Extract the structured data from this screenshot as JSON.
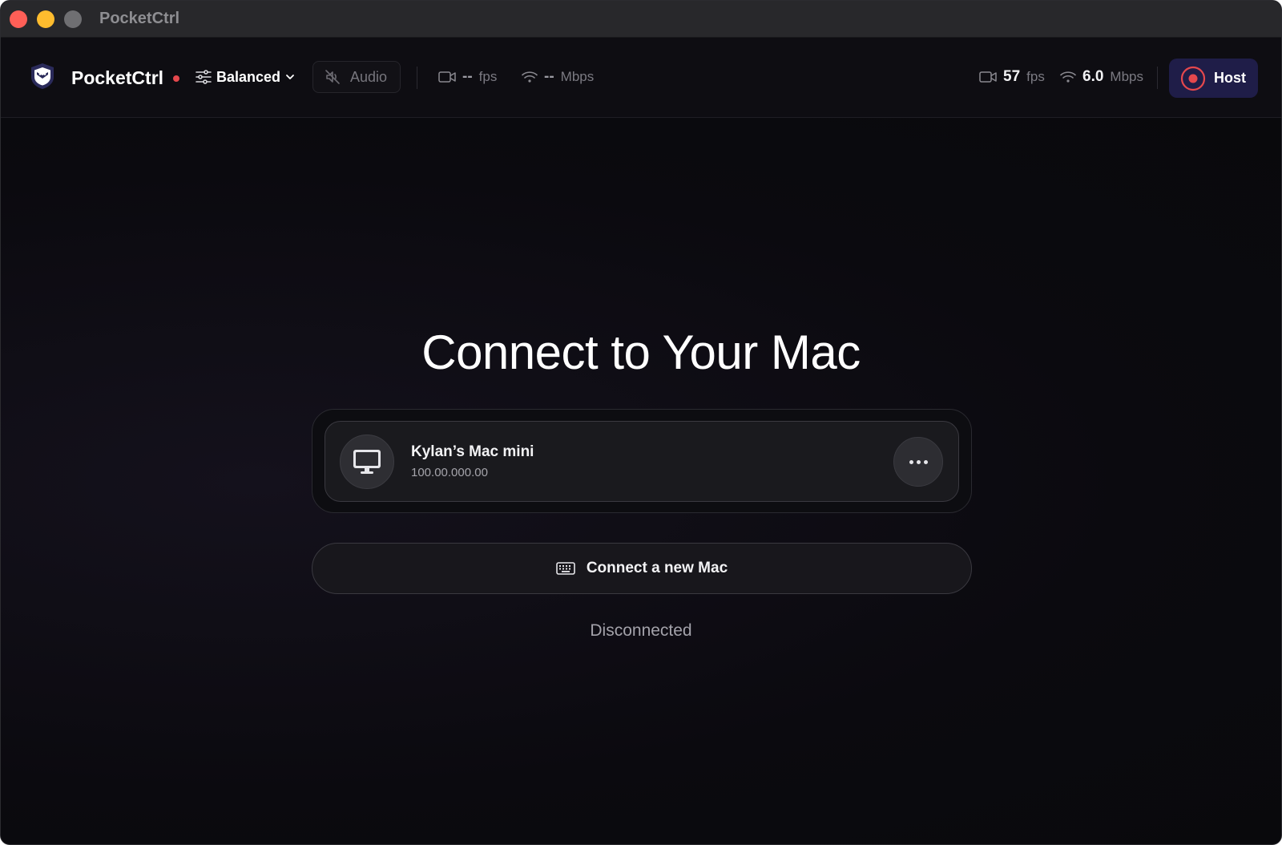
{
  "window": {
    "title": "PocketCtrl"
  },
  "toolbar": {
    "app_name": "PocketCtrl",
    "quality_label": "Balanced",
    "audio_label": "Audio",
    "remote_fps_value": "--",
    "remote_fps_unit": "fps",
    "remote_bw_value": "--",
    "remote_bw_unit": "Mbps",
    "local_fps_value": "57",
    "local_fps_unit": "fps",
    "local_bw_value": "6.0",
    "local_bw_unit": "Mbps",
    "host_label": "Host"
  },
  "main": {
    "heading": "Connect to Your Mac",
    "devices": [
      {
        "name": "Kylan’s Mac mini",
        "ip": "100.00.000.00",
        "icon": "monitor-icon"
      }
    ],
    "connect_new_label": "Connect a new Mac",
    "status_text": "Disconnected"
  },
  "icons": {
    "logo": "owl-shield-logo",
    "quality": "sliders-icon",
    "quality_chevron": "chevron-down-icon",
    "audio": "speaker-muted-icon",
    "fps": "video-camera-icon",
    "bandwidth": "wifi-icon",
    "host": "record-icon",
    "device": "monitor-icon",
    "more": "ellipsis-icon",
    "connect_new": "keyboard-icon"
  },
  "colors": {
    "status_dot": "#e5484d",
    "host_button_bg": "#1f1d48",
    "record_red": "#e5484d",
    "background": "#0a0a0d"
  }
}
